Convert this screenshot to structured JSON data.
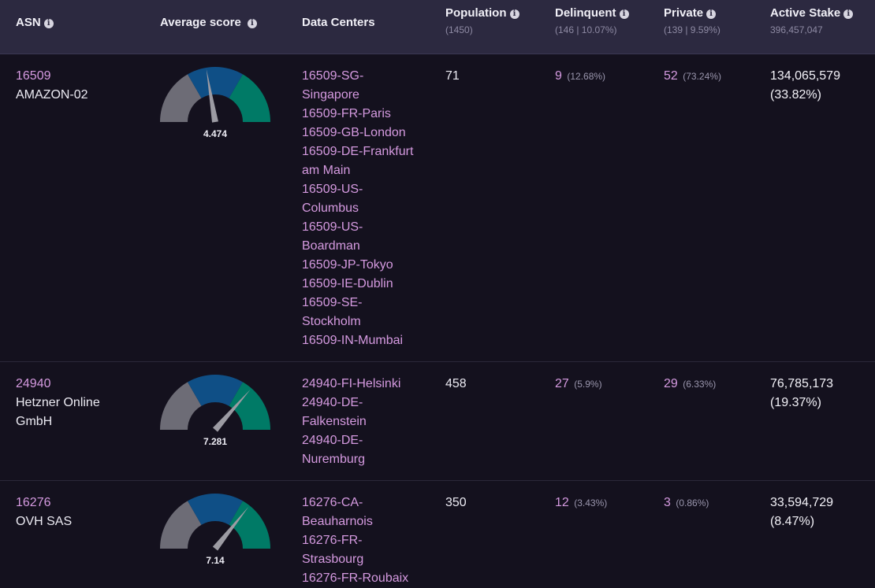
{
  "columns": {
    "asn": {
      "label": "ASN"
    },
    "avg_score": {
      "label": "Average score"
    },
    "data_centers": {
      "label": "Data Centers"
    },
    "population": {
      "label": "Population",
      "sub": "(1450)"
    },
    "delinquent": {
      "label": "Delinquent",
      "sub": "(146 | 10.07%)"
    },
    "private": {
      "label": "Private",
      "sub": "(139 | 9.59%)"
    },
    "active_stake": {
      "label": "Active Stake",
      "sub": "396,457,047"
    }
  },
  "rows": [
    {
      "asn": "16509",
      "name": "AMAZON-02",
      "score": "4.474",
      "score_value": 4.474,
      "data_centers": [
        "16509-SG-",
        "Singapore",
        "16509-FR-Paris",
        "16509-GB-London",
        "16509-DE-Frankfurt",
        "am Main",
        "16509-US-",
        "Columbus",
        "16509-US-",
        "Boardman",
        "16509-JP-Tokyo",
        "16509-IE-Dublin",
        "16509-SE-",
        "Stockholm",
        "16509-IN-Mumbai"
      ],
      "population": "71",
      "delinquent": "9",
      "delinquent_pct": "(12.68%)",
      "private": "52",
      "private_pct": "(73.24%)",
      "stake": "134,065,579",
      "stake_pct": "(33.82%)"
    },
    {
      "asn": "24940",
      "name": "Hetzner Online",
      "name2": "GmbH",
      "score": "7.281",
      "score_value": 7.281,
      "data_centers": [
        "24940-FI-Helsinki",
        "24940-DE-",
        "Falkenstein",
        "24940-DE-",
        "Nuremburg"
      ],
      "population": "458",
      "delinquent": "27",
      "delinquent_pct": "(5.9%)",
      "private": "29",
      "private_pct": "(6.33%)",
      "stake": "76,785,173",
      "stake_pct": "(19.37%)"
    },
    {
      "asn": "16276",
      "name": "OVH SAS",
      "score": "7.14",
      "score_value": 7.14,
      "data_centers": [
        "16276-CA-",
        "Beauharnois",
        "16276-FR-",
        "Strasbourg",
        "16276-FR-Roubaix"
      ],
      "population": "350",
      "delinquent": "12",
      "delinquent_pct": "(3.43%)",
      "private": "3",
      "private_pct": "(0.86%)",
      "stake": "33,594,729",
      "stake_pct": "(8.47%)"
    }
  ],
  "gauge": {
    "min": 0,
    "max": 10,
    "colors": {
      "low": "#6d6c76",
      "mid": "#0f4f86",
      "high": "#007a66",
      "needle": "#9c9ba3"
    }
  },
  "icons": {
    "info": "info-icon"
  }
}
